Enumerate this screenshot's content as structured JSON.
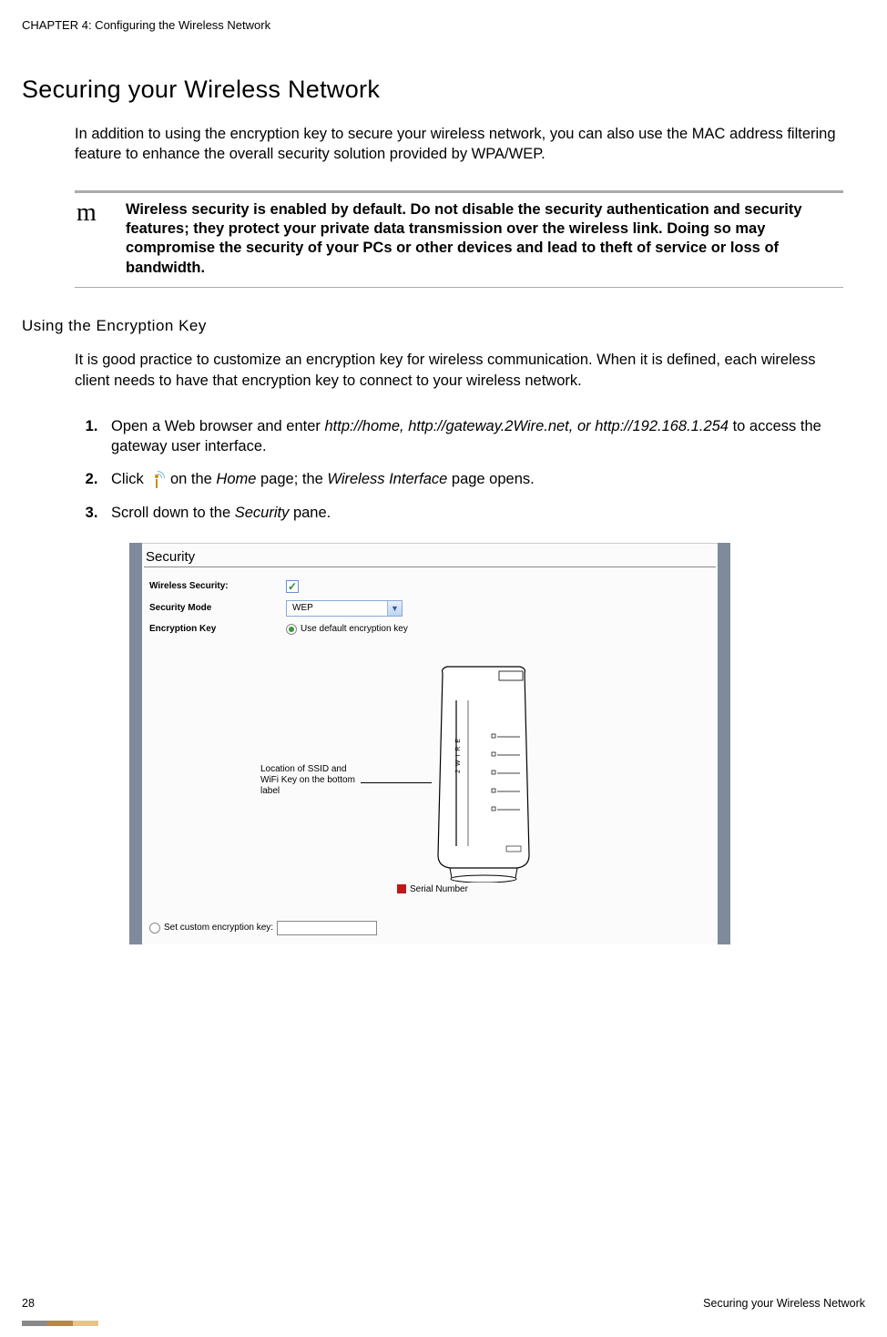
{
  "chapter_header": "CHAPTER 4: Configuring the Wireless Network",
  "main_heading": "Securing your Wireless Network",
  "intro_para": "In addition to using the encryption key to secure your wireless network, you can also use the MAC address filtering feature to enhance the overall security solution provided by WPA/WEP.",
  "note_icon": "m",
  "note_text": "Wireless security is enabled by default. Do not disable the security authentication and security features; they protect your private data transmission over the wireless link. Doing so may compromise the security of your PCs or other devices and lead to theft of service or loss of bandwidth.",
  "sub_heading": "Using the Encryption Key",
  "sub_para": "It is good practice to customize an encryption key for wireless communication. When it is defined, each wireless client needs to have that encryption key to connect to your wireless network.",
  "steps": {
    "s1_a": "Open a Web browser and enter ",
    "s1_i": "http://home, http://gateway.2Wire.net, or http://192.168.1.254",
    "s1_b": " to access the gateway user interface.",
    "s2_a": "Click ",
    "s2_b": " on the ",
    "s2_i1": "Home",
    "s2_c": " page; the ",
    "s2_i2": "Wireless Interface",
    "s2_d": " page opens.",
    "s3_a": "Scroll down to the ",
    "s3_i": "Security",
    "s3_b": " pane."
  },
  "panel": {
    "title": "Security",
    "wireless_security_label": "Wireless Security:",
    "security_mode_label": "Security Mode",
    "security_mode_value": "WEP",
    "encryption_key_label": "Encryption Key",
    "use_default_label": "Use default encryption key",
    "callout": "Location of SSID and WiFi Key on the bottom label",
    "device_brand": "2WIRE",
    "serial_label": "Serial Number",
    "custom_key_label": "Set custom encryption key:"
  },
  "footer": {
    "page_num": "28",
    "section": "Securing your Wireless Network"
  }
}
